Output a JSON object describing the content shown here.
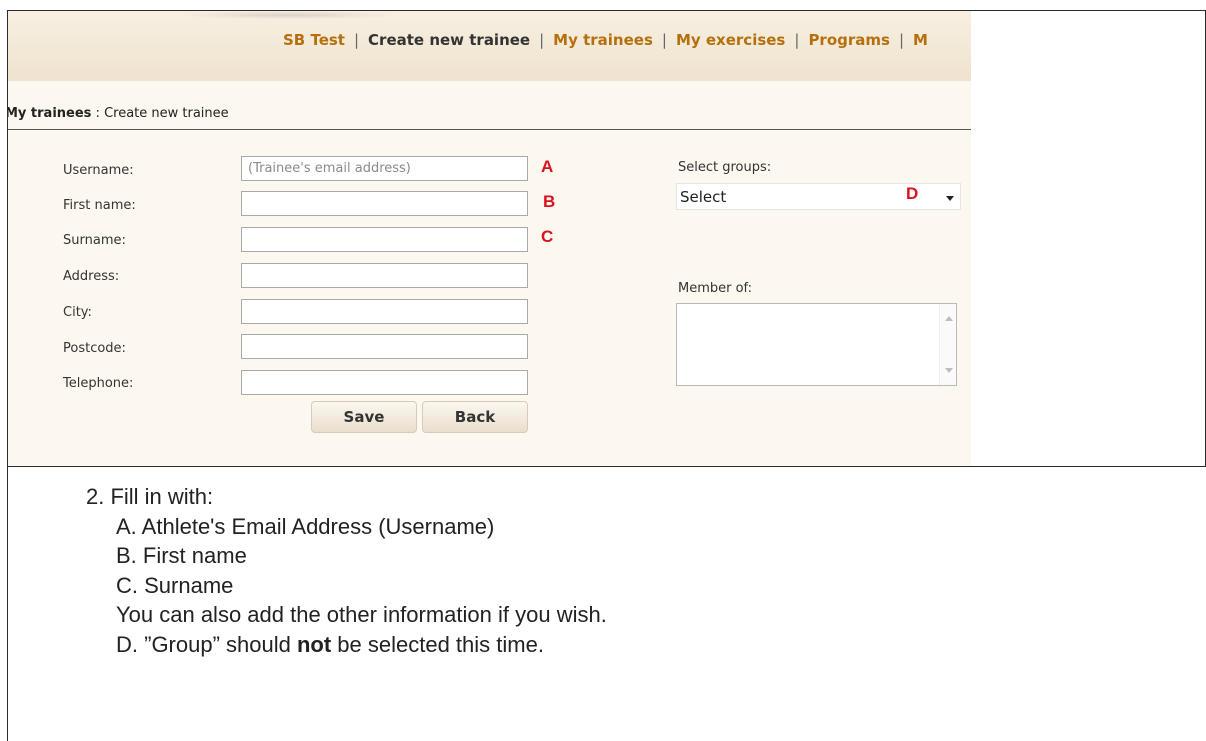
{
  "nav": {
    "items": [
      {
        "label": "SB Test",
        "active": false
      },
      {
        "label": "Create new trainee",
        "active": true
      },
      {
        "label": "My trainees",
        "active": false
      },
      {
        "label": "My exercises",
        "active": false
      },
      {
        "label": "Programs",
        "active": false
      },
      {
        "label": "M",
        "active": false
      }
    ],
    "separator": "|"
  },
  "breadcrumb": {
    "parent": "My trainees",
    "current": " : Create new trainee"
  },
  "form": {
    "username_label": "Username:",
    "username_placeholder": "(Trainee's email address)",
    "firstname_label": "First name:",
    "surname_label": "Surname:",
    "address_label": "Address:",
    "city_label": "City:",
    "postcode_label": "Postcode:",
    "telephone_label": "Telephone:",
    "save_label": "Save",
    "back_label": "Back"
  },
  "groups": {
    "select_label": "Select groups:",
    "selected_value": "Select",
    "member_label": "Member of:"
  },
  "markers": {
    "a": "A",
    "b": "B",
    "c": "C",
    "d": "D"
  },
  "instructions": {
    "heading": "2.  Fill in with:",
    "item_a": "A. Athlete's Email Address (Username)",
    "item_b": "B. First name",
    "item_c": "C. Surname",
    "note": "You can also add the other information if you wish.",
    "item_d_pre": "D. ”Group” should ",
    "item_d_bold": "not",
    "item_d_post": " be selected this time."
  },
  "colors": {
    "nav_link": "#b5700d",
    "marker": "#d9121f",
    "page_bg": "#fdf8ef"
  }
}
